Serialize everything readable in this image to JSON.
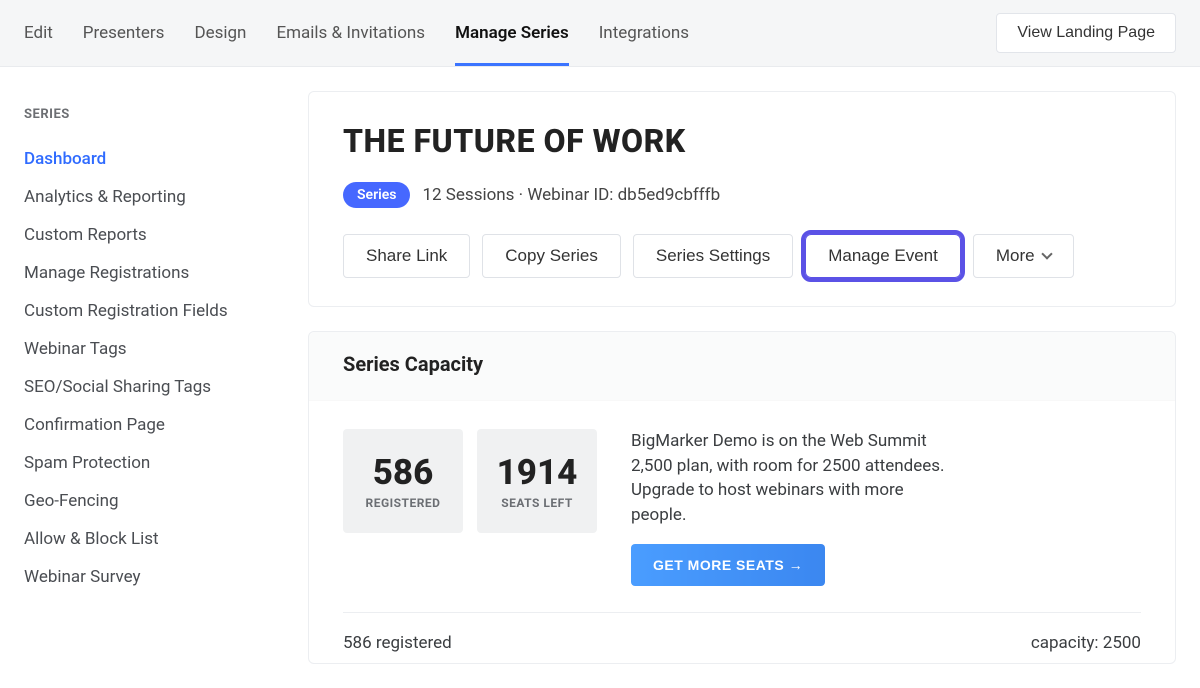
{
  "topnav": {
    "tabs": [
      {
        "label": "Edit"
      },
      {
        "label": "Presenters"
      },
      {
        "label": "Design"
      },
      {
        "label": "Emails & Invitations"
      },
      {
        "label": "Manage Series",
        "active": true
      },
      {
        "label": "Integrations"
      }
    ],
    "view_landing_label": "View Landing Page"
  },
  "sidebar": {
    "header": "SERIES",
    "items": [
      {
        "label": "Dashboard",
        "active": true
      },
      {
        "label": "Analytics & Reporting"
      },
      {
        "label": "Custom Reports"
      },
      {
        "label": "Manage Registrations"
      },
      {
        "label": "Custom Registration Fields"
      },
      {
        "label": "Webinar Tags"
      },
      {
        "label": "SEO/Social Sharing Tags"
      },
      {
        "label": "Confirmation Page"
      },
      {
        "label": "Spam Protection"
      },
      {
        "label": "Geo-Fencing"
      },
      {
        "label": "Allow & Block List"
      },
      {
        "label": "Webinar Survey"
      }
    ]
  },
  "series": {
    "title": "THE FUTURE OF WORK",
    "badge": "Series",
    "meta": "12 Sessions · Webinar ID: db5ed9cbfffb",
    "sessions_count": 12,
    "webinar_id": "db5ed9cbfffb",
    "actions": {
      "share": "Share Link",
      "copy": "Copy Series",
      "settings": "Series Settings",
      "manage_event": "Manage Event",
      "more": "More"
    }
  },
  "capacity": {
    "header": "Series Capacity",
    "registered_value": "586",
    "registered_label": "REGISTERED",
    "seats_left_value": "1914",
    "seats_left_label": "SEATS LEFT",
    "description": "BigMarker Demo is on the Web Summit 2,500 plan, with room for 2500 attendees. Upgrade to host webinars with more people.",
    "cta_label": "GET MORE SEATS →",
    "footer_left": "586 registered",
    "footer_right": "capacity: 2500",
    "capacity_total": 2500
  }
}
